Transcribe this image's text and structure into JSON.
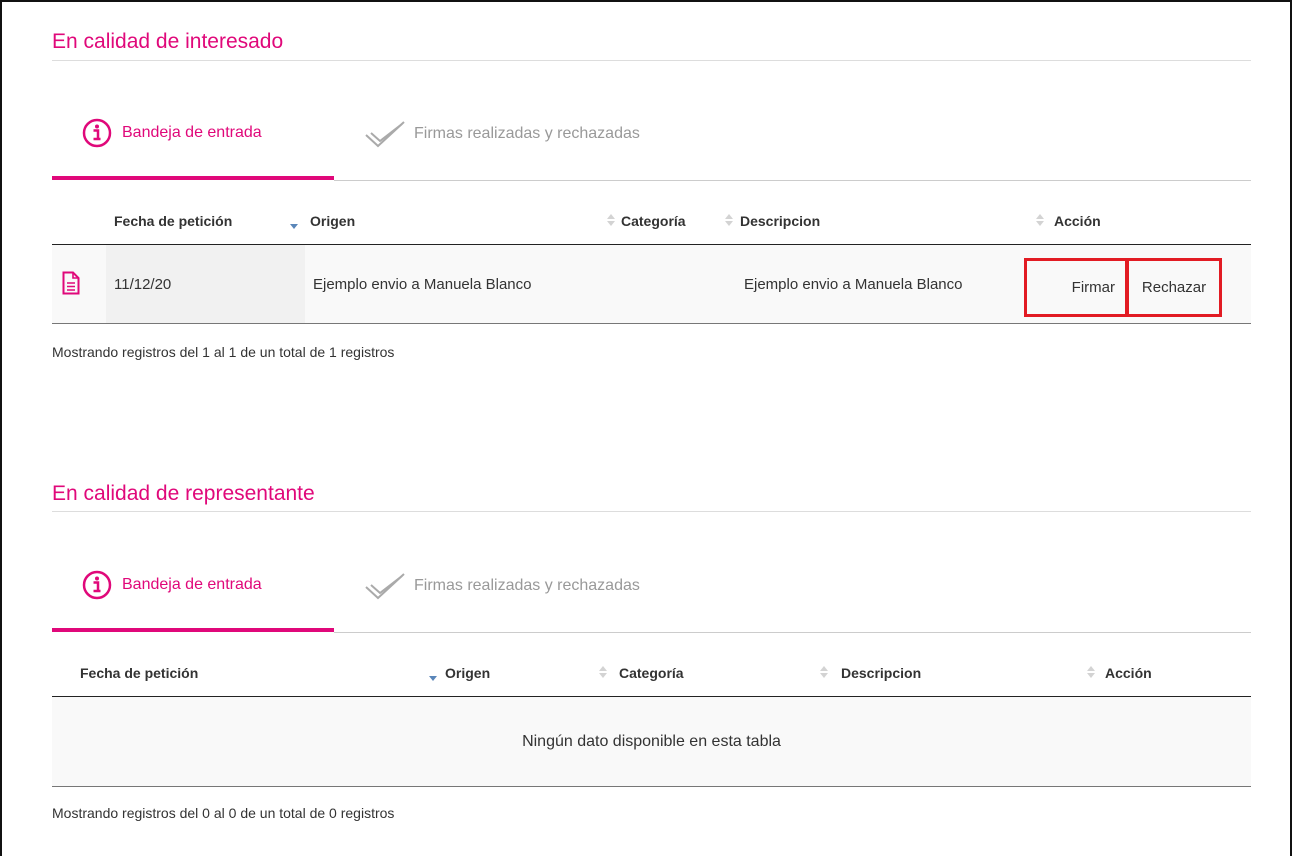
{
  "interesado": {
    "title": "En calidad de interesado",
    "tabs": [
      {
        "label": "Bandeja de entrada"
      },
      {
        "label": "Firmas realizadas y rechazadas"
      }
    ],
    "columns": [
      "Fecha de petición",
      "Origen",
      "Categoría",
      "Descripcion",
      "Acción"
    ],
    "rows": [
      {
        "fecha": "11/12/20",
        "origen": "Ejemplo envio a Manuela Blanco",
        "categoria": "",
        "descripcion": "Ejemplo envio a Manuela Blanco",
        "firmar": "Firmar",
        "rechazar": "Rechazar"
      }
    ],
    "info": "Mostrando registros del 1 al 1 de un total de 1 registros"
  },
  "representante": {
    "title": "En calidad de representante",
    "tabs": [
      {
        "label": "Bandeja de entrada"
      },
      {
        "label": "Firmas realizadas y rechazadas"
      }
    ],
    "columns": [
      "Fecha de petición",
      "Origen",
      "Categoría",
      "Descripcion",
      "Acción"
    ],
    "empty": "Ningún dato disponible en esta tabla",
    "info": "Mostrando registros del 0 al 0 de un total de 0 registros"
  },
  "colors": {
    "accent": "#e0087a",
    "highlight": "#e21b23",
    "sort_active": "#5a86b9"
  }
}
